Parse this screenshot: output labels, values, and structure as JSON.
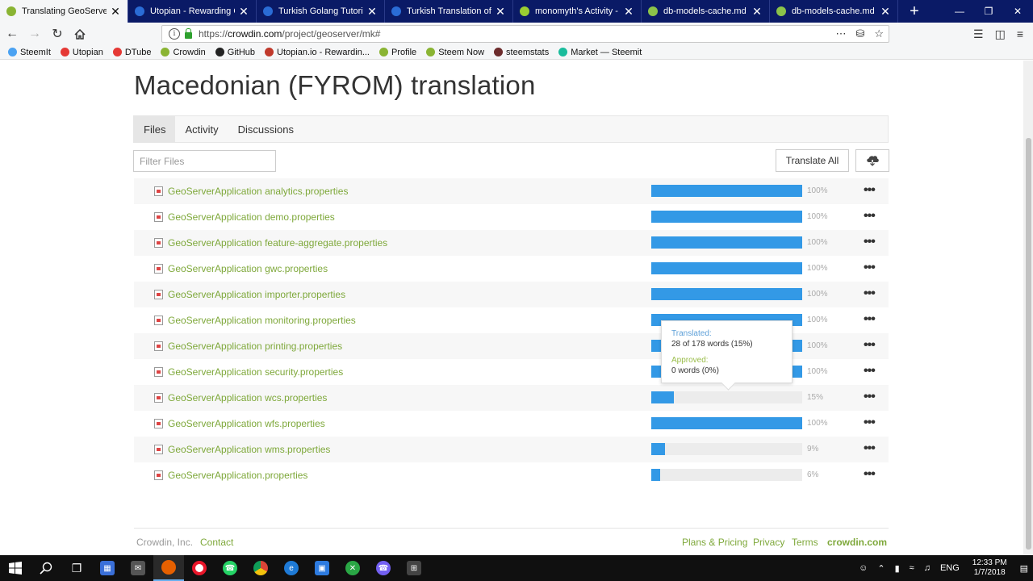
{
  "browser": {
    "tabs": [
      {
        "label": "Translating GeoServer to M",
        "favicon": "crowdin-icon",
        "active": true
      },
      {
        "label": "Utopian - Rewarding Ope",
        "favicon": "utopian-icon",
        "active": false
      },
      {
        "label": "Turkish Golang Tutorial G",
        "favicon": "utopian-icon",
        "active": false
      },
      {
        "label": "Turkish Translation of ERP",
        "favicon": "utopian-icon",
        "active": false
      },
      {
        "label": "monomyth's Activity - Use",
        "favicon": "github-icon",
        "active": false
      },
      {
        "label": "db-models-cache.md - Pl",
        "favicon": "markdown-icon",
        "active": false
      },
      {
        "label": "db-models-cache.md - Pl",
        "favicon": "markdown-icon",
        "active": false
      }
    ],
    "url_prefix": "https://",
    "url_domain": "crowdin.com",
    "url_path": "/project/geoserver/mk#",
    "bookmarks": [
      {
        "label": "SteemIt",
        "color": "#4ba2f2"
      },
      {
        "label": "Utopian",
        "color": "#e53935"
      },
      {
        "label": "DTube",
        "color": "#e53935"
      },
      {
        "label": "Crowdin",
        "color": "#8ab433"
      },
      {
        "label": "GitHub",
        "color": "#222222"
      },
      {
        "label": "Utopian.io - Rewardin...",
        "color": "#c0392b"
      },
      {
        "label": "Profile",
        "color": "#8ab433"
      },
      {
        "label": "Steem Now",
        "color": "#8ab433"
      },
      {
        "label": "steemstats",
        "color": "#6d2c2c"
      },
      {
        "label": "Market — Steemit",
        "color": "#1abc9c"
      }
    ]
  },
  "page": {
    "title": "Macedonian (FYROM) translation",
    "tabs": [
      "Files",
      "Activity",
      "Discussions"
    ],
    "filter_placeholder": "Filter Files",
    "translate_all": "Translate All"
  },
  "files": [
    {
      "name": "GeoServerApplication analytics.properties",
      "progress": 100,
      "pct_label": "100%"
    },
    {
      "name": "GeoServerApplication demo.properties",
      "progress": 100,
      "pct_label": "100%"
    },
    {
      "name": "GeoServerApplication feature-aggregate.properties",
      "progress": 100,
      "pct_label": "100%"
    },
    {
      "name": "GeoServerApplication gwc.properties",
      "progress": 100,
      "pct_label": "100%"
    },
    {
      "name": "GeoServerApplication importer.properties",
      "progress": 100,
      "pct_label": "100%"
    },
    {
      "name": "GeoServerApplication monitoring.properties",
      "progress": 100,
      "pct_label": "100%"
    },
    {
      "name": "GeoServerApplication printing.properties",
      "progress": 100,
      "pct_label": "100%"
    },
    {
      "name": "GeoServerApplication security.properties",
      "progress": 100,
      "pct_label": "100%"
    },
    {
      "name": "GeoServerApplication wcs.properties",
      "progress": 15,
      "pct_label": "15%"
    },
    {
      "name": "GeoServerApplication wfs.properties",
      "progress": 100,
      "pct_label": "100%"
    },
    {
      "name": "GeoServerApplication wms.properties",
      "progress": 9,
      "pct_label": "9%"
    },
    {
      "name": "GeoServerApplication.properties",
      "progress": 6,
      "pct_label": "6%"
    }
  ],
  "tooltip": {
    "translated_label": "Translated:",
    "translated_value": "28 of 178 words (15%)",
    "approved_label": "Approved:",
    "approved_value": "0 words (0%)"
  },
  "footer": {
    "company": "Crowdin, Inc.",
    "contact": "Contact",
    "pricing": "Plans & Pricing",
    "privacy": "Privacy",
    "terms": "Terms",
    "brand": "crowdin.com"
  },
  "taskbar": {
    "language": "ENG",
    "time": "12:33 PM",
    "date": "1/7/2018"
  },
  "colors": {
    "accent_green": "#7ea83a",
    "progress_blue": "#3399e6",
    "tabstrip": "#0a1a66"
  }
}
